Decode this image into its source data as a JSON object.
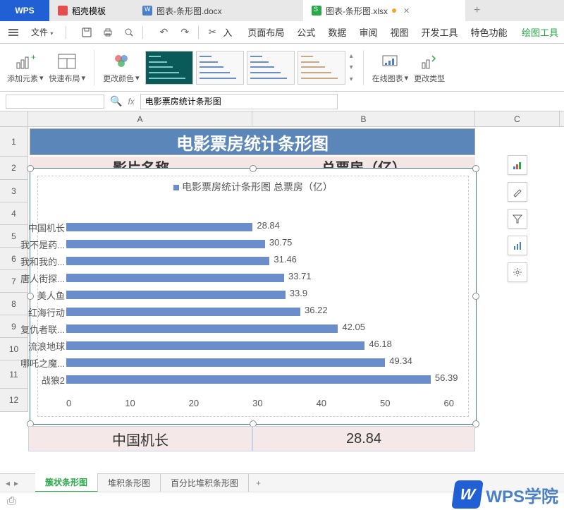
{
  "tabs": {
    "wps": "WPS",
    "template": "稻壳模板",
    "docx": "图表-条形图.docx",
    "xlsx": "图表-条形图.xlsx"
  },
  "menu": {
    "file": "文件",
    "ribbon_tabs": [
      "页面布局",
      "公式",
      "数据",
      "审阅",
      "视图",
      "开发工具",
      "特色功能"
    ],
    "chart_tool": "绘图工具",
    "insert_label": "入"
  },
  "ribbon": {
    "add_element": "添加元素",
    "quick_layout": "快速布局",
    "change_color": "更改颜色",
    "online_chart": "在线图表",
    "change_type": "更改类型"
  },
  "formula_bar": {
    "fx": "fx",
    "value": "电影票房统计条形图"
  },
  "columns": {
    "a": "A",
    "b": "B",
    "c": "C"
  },
  "rows": [
    "1",
    "2",
    "3",
    "4",
    "5",
    "6",
    "7",
    "8",
    "9",
    "10",
    "11",
    "12"
  ],
  "sheet_title": "电影票房统计条形图",
  "header_row": {
    "name": "影片名称",
    "value": "总票房（亿）"
  },
  "row12": {
    "name": "中国机长",
    "value": "28.84"
  },
  "chart_data": {
    "type": "bar",
    "title": "电影票房统计条形图 总票房（亿）",
    "legend": "电影票房统计条\n形图 总票房（亿）",
    "categories": [
      "中国机长",
      "我不是药...",
      "我和我的...",
      "唐人街探...",
      "美人鱼",
      "红海行动",
      "复仇者联...",
      "流浪地球",
      "哪吒之魔...",
      "战狼2"
    ],
    "values": [
      28.84,
      30.75,
      31.46,
      33.71,
      33.9,
      36.22,
      42.05,
      46.18,
      49.34,
      56.39
    ],
    "xlim": [
      0,
      60
    ],
    "xticks": [
      0,
      10,
      20,
      30,
      40,
      50,
      60
    ],
    "xlabel": "",
    "ylabel": ""
  },
  "sheet_tabs": {
    "active": "簇状条形图",
    "t2": "堆积条形图",
    "t3": "百分比堆积条形图"
  },
  "watermark": "WPS学院",
  "float_tools": [
    "chart-elements",
    "brush",
    "filter",
    "data",
    "settings"
  ]
}
